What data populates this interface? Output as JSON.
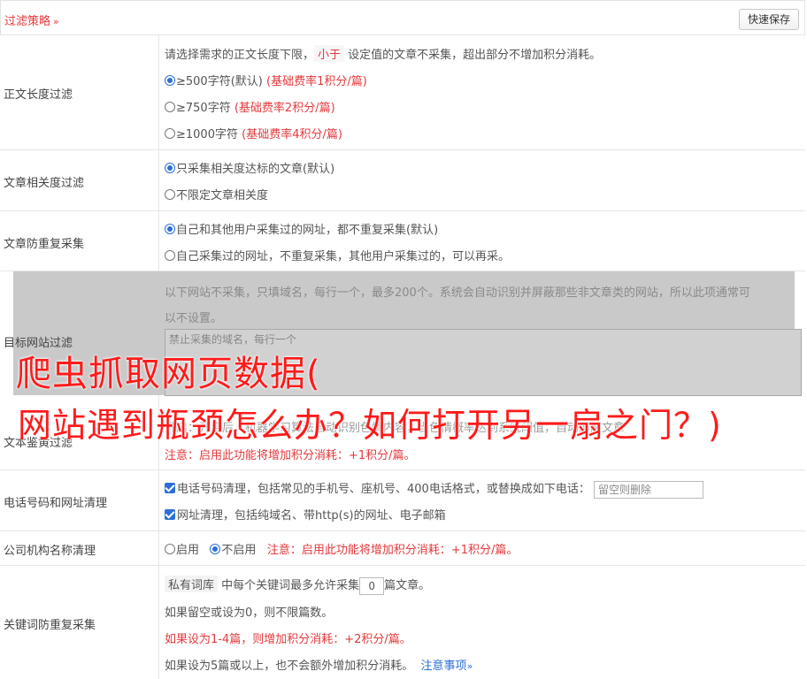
{
  "header": {
    "title": "过滤策略",
    "chevron": "»",
    "save_button": "快速保存"
  },
  "length_filter": {
    "label": "正文长度过滤",
    "desc_before": "请选择需求的正文长度下限，",
    "desc_tag": "小于",
    "desc_after": "设定值的文章不采集，超出部分不增加积分消耗。",
    "options": [
      {
        "text": "≥500字符(默认)",
        "cost": "(基础费率1积分/篇)",
        "selected": true
      },
      {
        "text": "≥750字符",
        "cost": "(基础费率2积分/篇)",
        "selected": false
      },
      {
        "text": "≥1000字符",
        "cost": "(基础费率4积分/篇)",
        "selected": false
      }
    ]
  },
  "relevance_filter": {
    "label": "文章相关度过滤",
    "options": [
      {
        "text": "只采集相关度达标的文章(默认)",
        "selected": true
      },
      {
        "text": "不限定文章相关度",
        "selected": false
      }
    ]
  },
  "duplicate_filter": {
    "label": "文章防重复采集",
    "options": [
      {
        "text": "自己和其他用户采集过的网址，都不重复采集(默认)",
        "selected": true
      },
      {
        "text": "自己采集过的网址，不重复采集，其他用户采集过的，可以再采。",
        "selected": false
      }
    ]
  },
  "site_filter": {
    "label": "目标网站过滤",
    "desc_line1": "以下网站不采集，只填域名，每行一个，最多200个。系统会自动识别并屏蔽那些非文章类的网站，所以此项通常可",
    "desc_line2": "以不设置。",
    "placeholder": "禁止采集的域名，每行一个"
  },
  "porn_filter": {
    "label": "文本鉴黄过滤",
    "partial_line": "开启：开启后，机器学习算法自动识别色情内容，当色情概率达到系统阈值，自动屏蔽文章",
    "note": "注意：启用此功能将增加积分消耗：+1积分/篇。"
  },
  "phone_filter": {
    "label": "电话号码和网址清理",
    "phone_text": "电话号码清理，包括常见的手机号、座机号、400电话格式，或替换成如下电话：",
    "phone_placeholder": "留空则删除",
    "url_text": "网址清理，包括纯域名、带http(s)的网址、电子邮箱"
  },
  "company_filter": {
    "label": "公司机构名称清理",
    "enable": "启用",
    "disable": "不启用",
    "note": "注意：启用此功能将增加积分消耗：+1积分/篇。"
  },
  "keyword_filter": {
    "label": "关键词防重复采集",
    "tag": "私有词库",
    "text_before": "中每个关键词最多允许采集",
    "value": "0",
    "text_after": "篇文章。",
    "line2": "如果留空或设为0，则不限篇数。",
    "line3": "如果设为1-4篇，则增加积分消耗：+2积分/篇。",
    "line4": "如果设为5篇或以上，也不会额外增加积分消耗。",
    "link": "注意事项",
    "link_chevron": "»"
  },
  "overlay": {
    "line1": "爬虫抓取网页数据(",
    "line2": "网站遇到瓶颈怎么办？如何打开另一扇之门？)"
  },
  "colors": {
    "accent_red": "#e4393c",
    "link_blue": "#2b6fd6",
    "overlay_red": "#ff1a1a"
  }
}
